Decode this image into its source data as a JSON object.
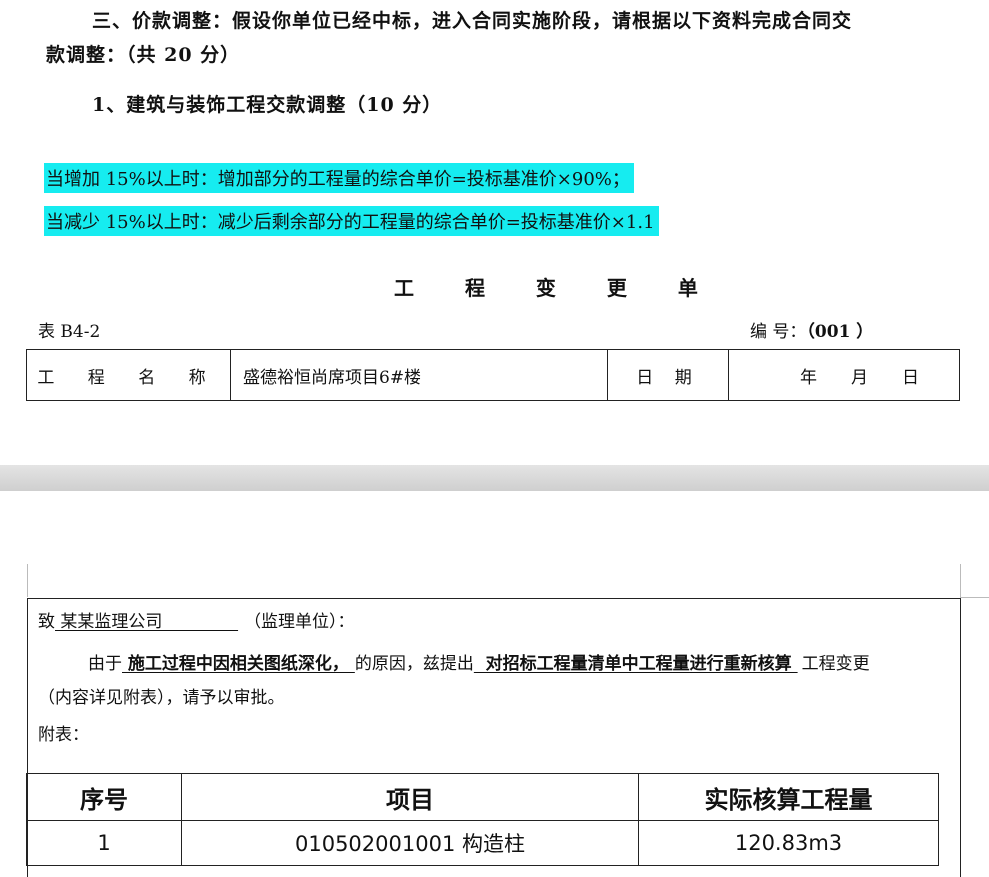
{
  "section_heading_line1": "三、价款调整：假设你单位已经中标，进入合同实施阶段，请根据以下资料完成合同交",
  "section_heading_line2": "款调整：（共 20 分）",
  "subheading": "1、建筑与装饰工程交款调整（10 分）",
  "rules": [
    "当增加 15%以上时：增加部分的工程量的综合单价=投标基准价×90%；",
    "当减少 15%以上时：减少后剩余部分的工程量的综合单价=投标基准价×1.1"
  ],
  "highlight_color": "#16ecf0",
  "form_title": "工 程 变 更 单",
  "form_code": "表 B4-2",
  "serial_label": "编  号：",
  "serial_value": "（001 ）",
  "info_row": {
    "project_name_label": "工 程 名 称",
    "project_name": "盛德裕恒尚席项目6#楼",
    "date_label": "日 期",
    "year": "年",
    "month": "月",
    "day": "日"
  },
  "letter": {
    "to_prefix": "致",
    "recipient": " 某某监理公司              ",
    "recipient_role": "（监理单位）：",
    "reason_prefix": "由于",
    "reason": " 施工过程中因相关图纸深化， ",
    "reason_mid": "的原因，兹提出",
    "proposal": "  对招标工程量清单中工程量进行重新核算 ",
    "proposal_suffix": "工程变更",
    "line2": "（内容详见附表），请予以审批。",
    "attachment_label": "附表："
  },
  "attachment_table": {
    "headers": [
      "序号",
      "项目",
      "实际核算工程量"
    ],
    "rows": [
      [
        "1",
        "010502001001 构造柱",
        "120.83m3"
      ]
    ]
  }
}
